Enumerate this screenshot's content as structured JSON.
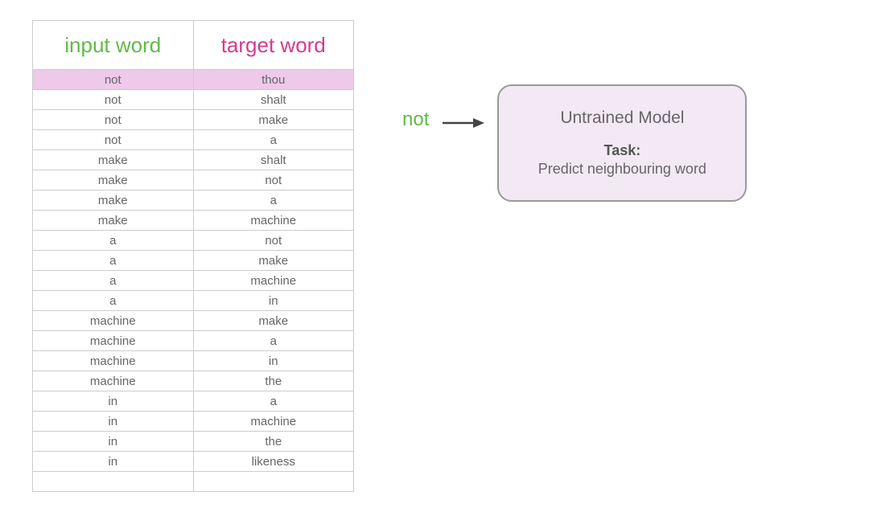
{
  "table": {
    "headers": {
      "input": "input word",
      "target": "target word"
    },
    "rows": [
      {
        "input": "not",
        "target": "thou",
        "highlighted": true
      },
      {
        "input": "not",
        "target": "shalt",
        "highlighted": false
      },
      {
        "input": "not",
        "target": "make",
        "highlighted": false
      },
      {
        "input": "not",
        "target": "a",
        "highlighted": false
      },
      {
        "input": "make",
        "target": "shalt",
        "highlighted": false
      },
      {
        "input": "make",
        "target": "not",
        "highlighted": false
      },
      {
        "input": "make",
        "target": "a",
        "highlighted": false
      },
      {
        "input": "make",
        "target": "machine",
        "highlighted": false
      },
      {
        "input": "a",
        "target": "not",
        "highlighted": false
      },
      {
        "input": "a",
        "target": "make",
        "highlighted": false
      },
      {
        "input": "a",
        "target": "machine",
        "highlighted": false
      },
      {
        "input": "a",
        "target": "in",
        "highlighted": false
      },
      {
        "input": "machine",
        "target": "make",
        "highlighted": false
      },
      {
        "input": "machine",
        "target": "a",
        "highlighted": false
      },
      {
        "input": "machine",
        "target": "in",
        "highlighted": false
      },
      {
        "input": "machine",
        "target": "the",
        "highlighted": false
      },
      {
        "input": "in",
        "target": "a",
        "highlighted": false
      },
      {
        "input": "in",
        "target": "machine",
        "highlighted": false
      },
      {
        "input": "in",
        "target": "the",
        "highlighted": false
      },
      {
        "input": "in",
        "target": "likeness",
        "highlighted": false
      },
      {
        "input": "",
        "target": "",
        "highlighted": false
      }
    ]
  },
  "diagram": {
    "input_word": "not",
    "model_title": "Untrained Model",
    "task_label": "Task:",
    "task_description": "Predict neighbouring word"
  }
}
